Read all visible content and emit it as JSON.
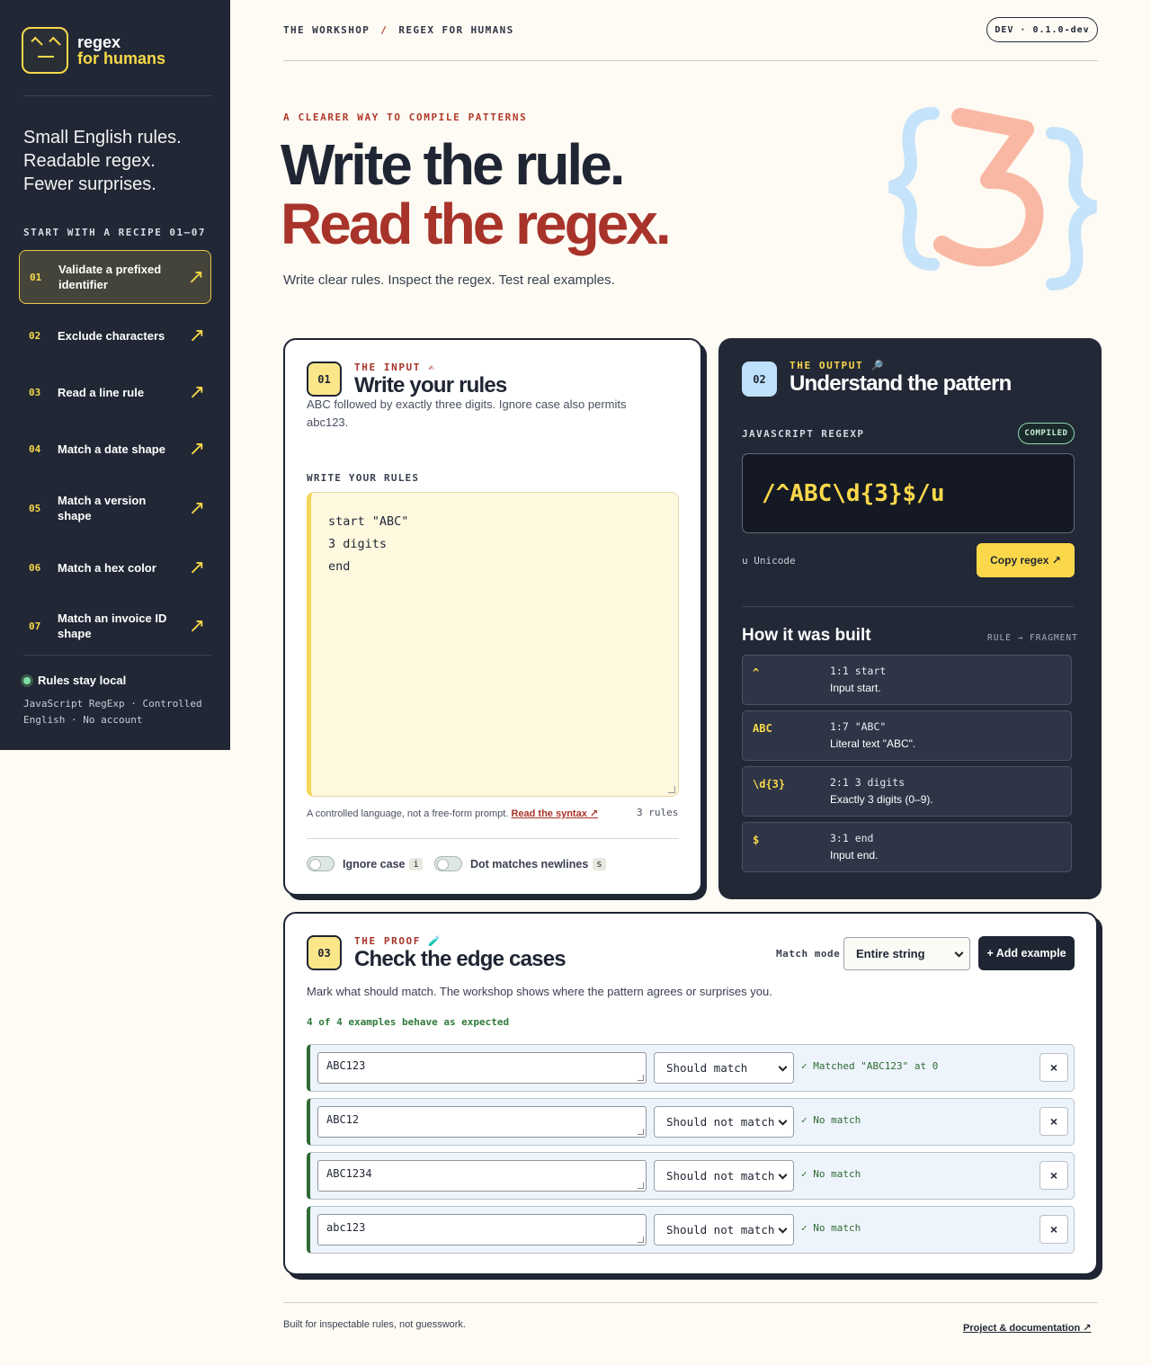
{
  "brand": {
    "line1": "regex",
    "line2": "for humans"
  },
  "sidebar": {
    "tagline": [
      "Small English rules.",
      "Readable regex.",
      "Fewer surprises."
    ],
    "recipes_heading": "START WITH A RECIPE",
    "recipes_range": "01–07",
    "recipes": [
      {
        "num": "01",
        "label": "Validate a prefixed identifier",
        "active": true
      },
      {
        "num": "02",
        "label": "Exclude characters"
      },
      {
        "num": "03",
        "label": "Read a line rule"
      },
      {
        "num": "04",
        "label": "Match a date shape"
      },
      {
        "num": "05",
        "label": "Match a version shape"
      },
      {
        "num": "06",
        "label": "Match a hex color"
      },
      {
        "num": "07",
        "label": "Match an invoice ID shape"
      }
    ],
    "local_label": "Rules stay local",
    "footer": "JavaScript RegExp · Controlled English · No account"
  },
  "topbar": {
    "crumb1": "THE WORKSHOP",
    "crumb_sep": "/",
    "crumb2": "REGEX FOR HUMANS",
    "version": "DEV · 0.1.0-dev"
  },
  "hero": {
    "eyebrow": "A CLEARER WAY TO COMPILE PATTERNS",
    "title_line1": "Write the rule.",
    "title_line2": "Read the regex.",
    "lead": "Write clear rules. Inspect the regex. Test real examples.",
    "art_text": "{3}"
  },
  "input_card": {
    "badge": "01",
    "eyebrow": "THE INPUT ✍",
    "title": "Write your rules",
    "description": "ABC followed by exactly three digits. Ignore case also permits abc123.",
    "field_label": "WRITE YOUR RULES",
    "rules": [
      "start \"ABC\"",
      "3 digits",
      "end"
    ],
    "hint": "A controlled language, not a free-form prompt.",
    "syntax_link": "Read the syntax ↗",
    "rule_count": "3 rules",
    "toggles": [
      {
        "label": "Ignore case",
        "flag": "i",
        "on": false
      },
      {
        "label": "Dot matches newlines",
        "flag": "s",
        "on": false
      }
    ]
  },
  "output_card": {
    "badge": "02",
    "eyebrow": "THE OUTPUT 🔎",
    "title": "Understand the pattern",
    "regex_label": "JAVASCRIPT REGEXP",
    "status": "COMPILED",
    "regex": "/^ABC\\d{3}$/u",
    "flags_note": "u Unicode",
    "copy_label": "Copy regex ↗",
    "built_title": "How it was built",
    "built_hint": "RULE → FRAGMENT",
    "fragments": [
      {
        "token": "^",
        "location": "1:1 start",
        "explanation": "Input start."
      },
      {
        "token": "ABC",
        "location": "1:7 \"ABC\"",
        "explanation": "Literal text \"ABC\"."
      },
      {
        "token": "\\d{3}",
        "location": "2:1 3 digits",
        "explanation": "Exactly 3 digits (0–9)."
      },
      {
        "token": "$",
        "location": "3:1 end",
        "explanation": "Input end."
      }
    ]
  },
  "proof_card": {
    "badge": "03",
    "eyebrow": "THE PROOF 🧪",
    "title": "Check the edge cases",
    "match_mode_label": "Match mode",
    "match_mode_value": "Entire string",
    "add_label": "+ Add example",
    "description": "Mark what should match. The workshop shows where the pattern agrees or surprises you.",
    "summary": "4 of 4 examples behave as expected",
    "examples": [
      {
        "value": "ABC123",
        "expectation": "Should match",
        "result": "✓ Matched \"ABC123\" at 0"
      },
      {
        "value": "ABC12",
        "expectation": "Should not match",
        "result": "✓ No match"
      },
      {
        "value": "ABC1234",
        "expectation": "Should not match",
        "result": "✓ No match"
      },
      {
        "value": "abc123",
        "expectation": "Should not match",
        "result": "✓ No match"
      }
    ],
    "delete_label": "×"
  },
  "footer": {
    "left": "Built for inspectable rules, not guesswork.",
    "right": "Project & documentation ↗"
  },
  "colors": {
    "sidebar_bg": "#212735",
    "accent_yellow": "#fbd84a",
    "accent_red": "#a8332a",
    "success_green": "#2f6a35",
    "page_bg": "#fdfbf3"
  },
  "icons": {
    "recipe_arrow": "arrow-up-right-icon",
    "logo": "smiley-face-icon",
    "status_dot": "status-dot-icon",
    "delete": "close-icon"
  }
}
